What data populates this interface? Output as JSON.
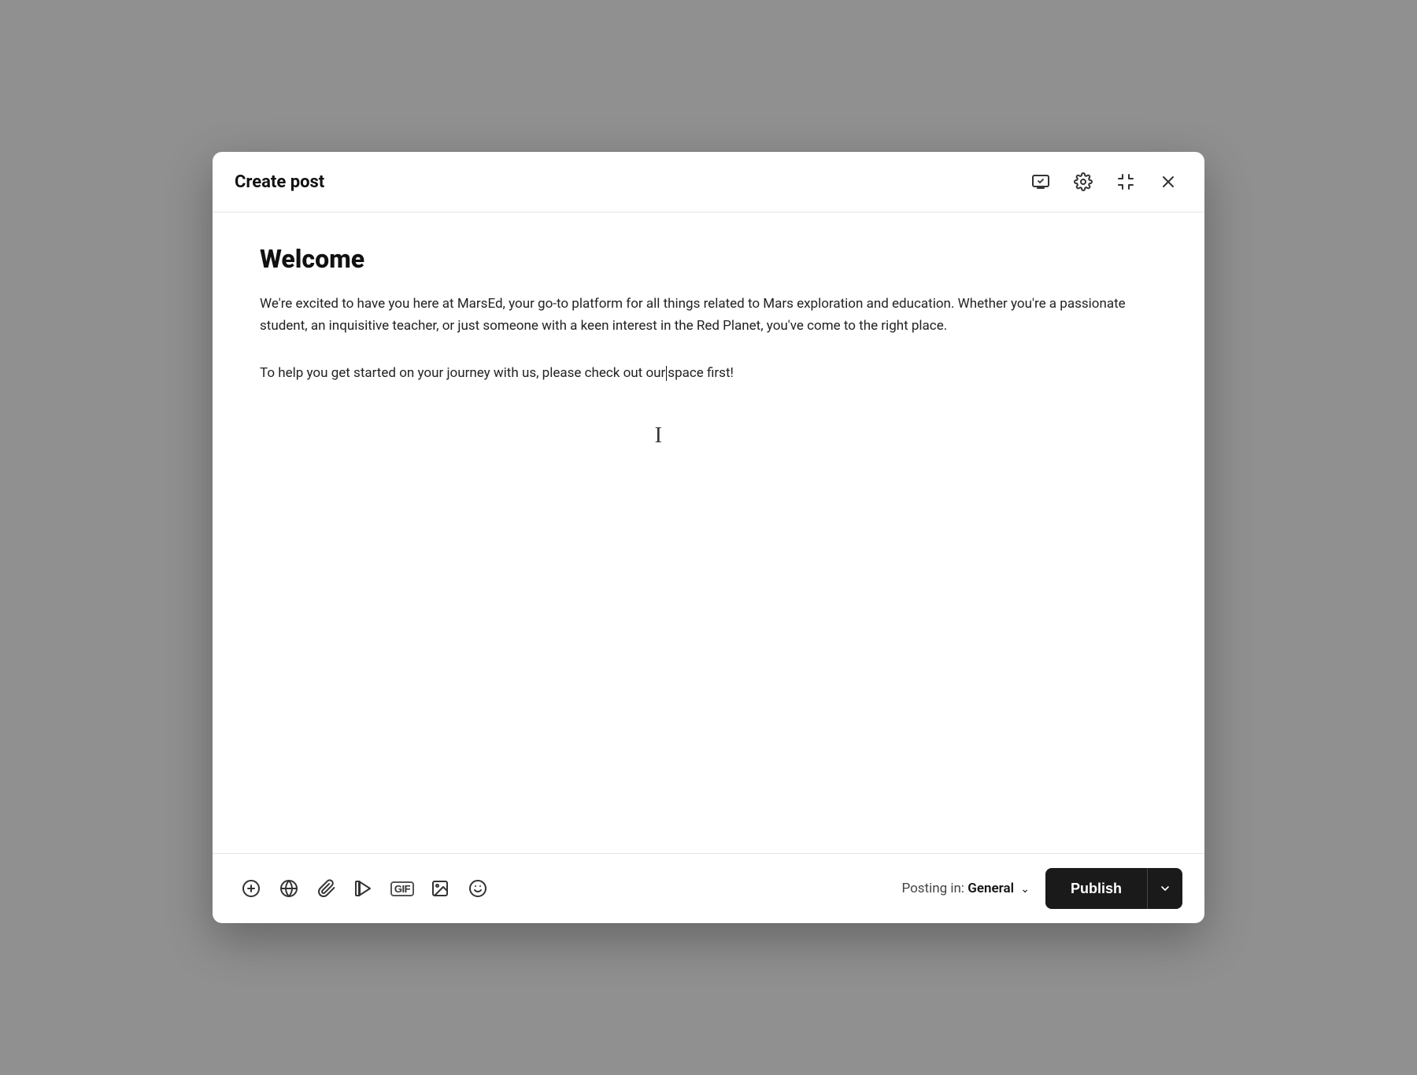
{
  "header": {
    "title": "Create post",
    "icons": {
      "embed": "embed-icon",
      "settings": "settings-icon",
      "minimize": "minimize-icon",
      "close": "close-icon"
    }
  },
  "content": {
    "heading": "Welcome",
    "paragraph1": "We're excited to have you here at MarsEd, your go-to platform for all things related to Mars exploration and education. Whether you're a passionate student, an inquisitive teacher, or just someone with a keen interest in the Red Planet, you've come to the right place.",
    "paragraph2_before_cursor": "To help you get started on your journey with us, please check out our",
    "paragraph2_after_cursor": "space first!"
  },
  "footer": {
    "posting_in_label": "Posting in:",
    "posting_in_value": "General",
    "publish_button": "Publish",
    "toolbar": {
      "add_icon": "add-icon",
      "embed_icon": "embed-content-icon",
      "attachment_icon": "attachment-icon",
      "video_icon": "video-icon",
      "gif_icon": "gif-icon",
      "image_icon": "image-icon",
      "emoji_icon": "emoji-icon"
    }
  },
  "colors": {
    "publish_bg": "#1a1a1a",
    "publish_text": "#ffffff",
    "heading_color": "#111111",
    "text_color": "#222222"
  }
}
